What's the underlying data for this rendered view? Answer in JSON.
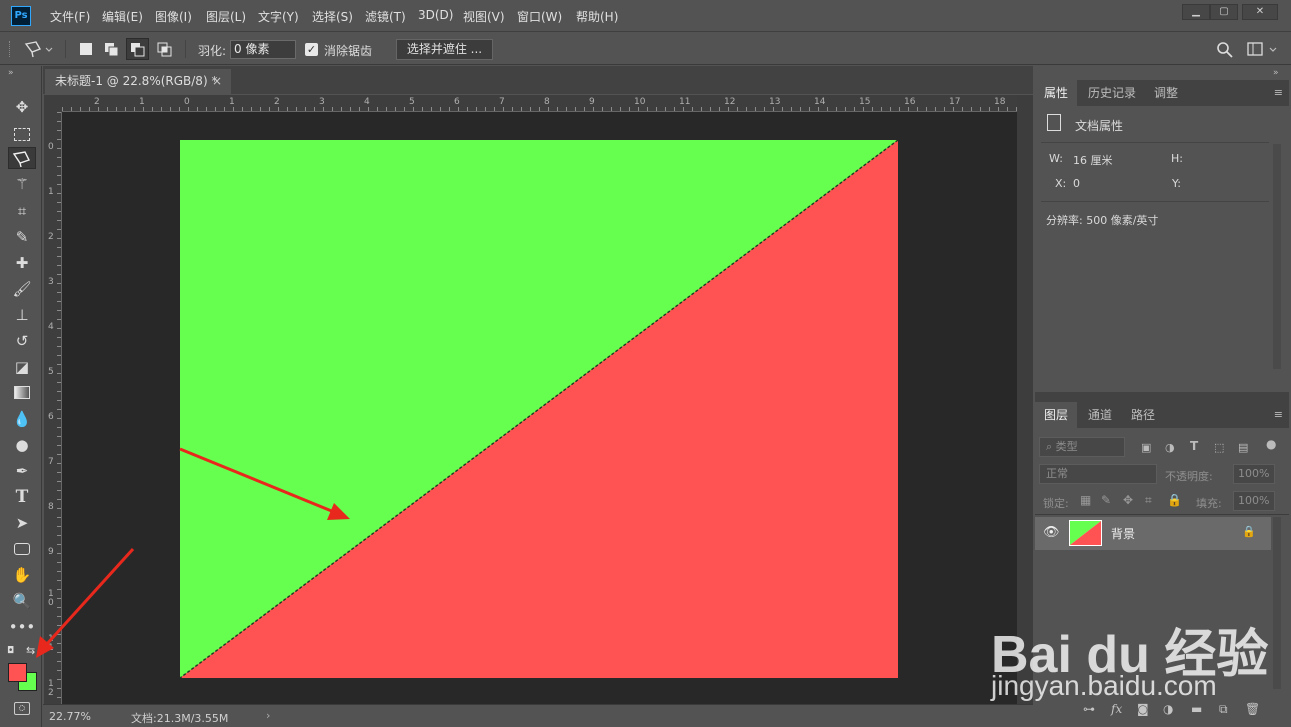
{
  "app": {
    "logo_text": "Ps"
  },
  "menu": [
    "文件(F)",
    "编辑(E)",
    "图像(I)",
    "图层(L)",
    "文字(Y)",
    "选择(S)",
    "滤镜(T)",
    "3D(D)",
    "视图(V)",
    "窗口(W)",
    "帮助(H)"
  ],
  "options": {
    "feather_label": "羽化:",
    "feather_value": "0 像素",
    "antialias_label": "消除锯齿",
    "antialias_checked": true,
    "select_mask_button": "选择并遮住 ..."
  },
  "document": {
    "tab_title": "未标题-1 @ 22.8%(RGB/8) *",
    "zoom": "22.77%",
    "doc_size": "文档:21.3M/3.55M"
  },
  "rulers": {
    "top": [
      "2",
      "1",
      "0",
      "1",
      "2",
      "3",
      "4",
      "5",
      "6",
      "7",
      "8",
      "9",
      "10",
      "11",
      "12",
      "13",
      "14",
      "15",
      "16",
      "17",
      "18"
    ],
    "left": [
      "0",
      "1",
      "2",
      "3",
      "4",
      "5",
      "6",
      "7",
      "8",
      "9",
      "1 0",
      "1 1",
      "1 2"
    ]
  },
  "colors": {
    "foreground": "#ff5252",
    "background": "#66ff4f",
    "canvas_green": "#66ff4f",
    "canvas_red": "#ff5252",
    "annotation_red": "#e8281c"
  },
  "properties_panel": {
    "tabs": [
      "属性",
      "历史记录",
      "调整"
    ],
    "section_title": "文档属性",
    "w_label": "W:",
    "w_value": "16 厘米",
    "h_label": "H:",
    "x_label": "X:",
    "x_value": "0",
    "y_label": "Y:",
    "resolution": "分辨率: 500 像素/英寸"
  },
  "layers_panel": {
    "tabs": [
      "图层",
      "通道",
      "路径"
    ],
    "filter_placeholder": "类型",
    "blend_mode": "正常",
    "opacity_label": "不透明度:",
    "opacity_value": "100%",
    "lock_label": "锁定:",
    "fill_label": "填充:",
    "fill_value": "100%",
    "layers": [
      {
        "name": "背景",
        "visible": true,
        "locked": true
      }
    ]
  },
  "watermark": {
    "brand": "Bai du 经验",
    "url": "jingyan.baidu.com"
  },
  "icons": [
    "move-icon",
    "marquee-icon",
    "polygonal-lasso-icon",
    "magic-wand-icon",
    "crop-icon",
    "eyedropper-icon",
    "healing-brush-icon",
    "brush-icon",
    "clone-stamp-icon",
    "history-brush-icon",
    "eraser-icon",
    "gradient-icon",
    "blur-icon",
    "dodge-icon",
    "pen-icon",
    "type-icon",
    "path-selection-icon",
    "shape-icon",
    "hand-icon",
    "zoom-icon",
    "more-icon"
  ]
}
